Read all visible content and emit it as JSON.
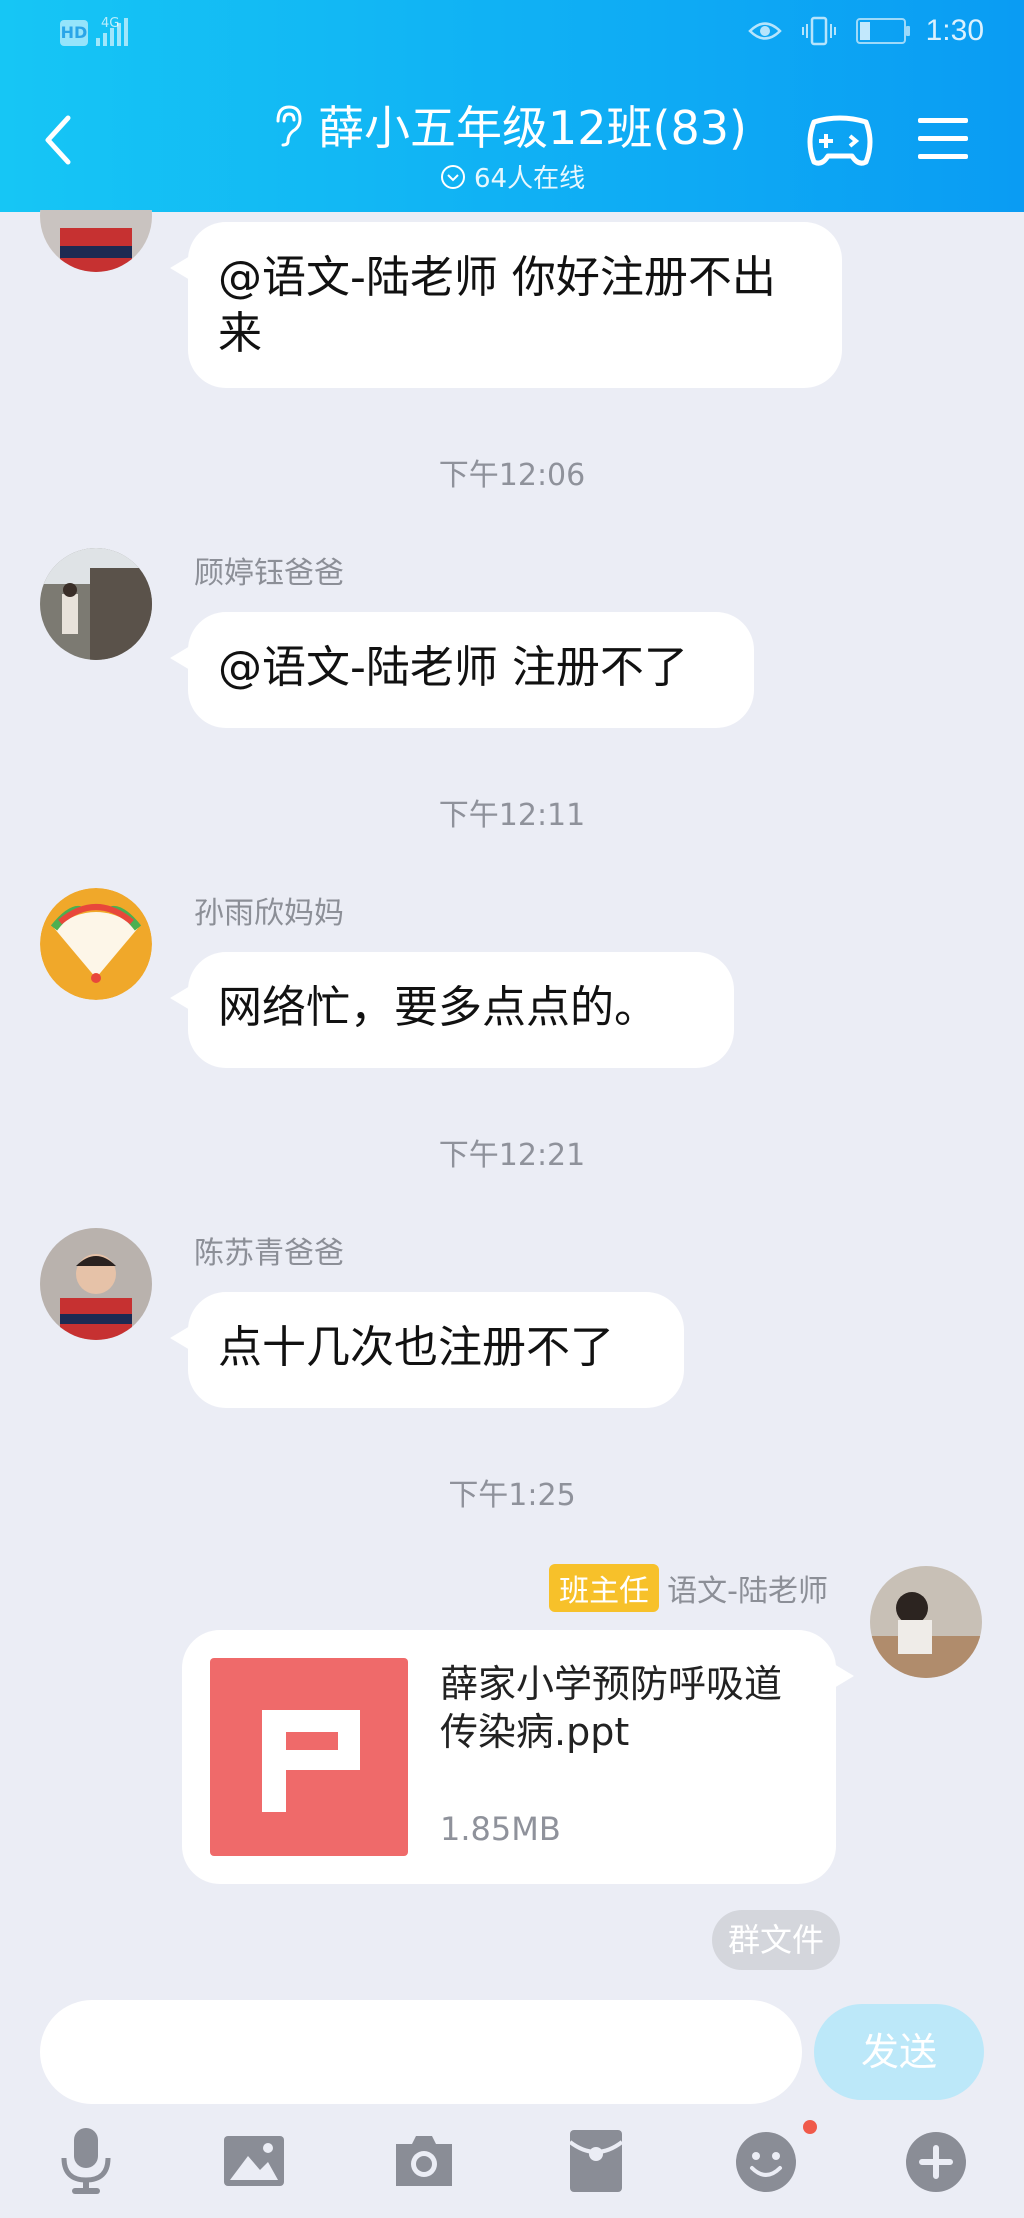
{
  "status_bar": {
    "hd": "HD",
    "network": "4G",
    "time": "1:30"
  },
  "header": {
    "title": "薛小五年级12班(83)",
    "online_text": "64人在线"
  },
  "messages": [
    {
      "text": "@语文-陆老师 你好注册不出来"
    },
    {
      "time": "下午12:06",
      "sender": "顾婷钰爸爸",
      "text": "@语文-陆老师 注册不了"
    },
    {
      "time": "下午12:11",
      "sender": "孙雨欣妈妈",
      "text": "网络忙，要多点点的。"
    },
    {
      "time": "下午12:21",
      "sender": "陈苏青爸爸",
      "text": "点十几次也注册不了"
    },
    {
      "time": "下午1:25",
      "role": "班主任",
      "sender": "语文-陆老师",
      "file": {
        "name": "薛家小学预防呼吸道传染病.ppt",
        "size": "1.85MB"
      }
    }
  ],
  "group_file_label": "群文件",
  "composer": {
    "placeholder": "",
    "send_label": "发送"
  },
  "toolbar": [
    "microphone-icon",
    "image-icon",
    "camera-icon",
    "red-packet-icon",
    "emoji-icon",
    "plus-icon"
  ],
  "colors": {
    "header_start": "#16c6f5",
    "header_end": "#0a9cf3",
    "background": "#ebedf5",
    "badge": "#f7c12a",
    "ppt": "#ef6a6a"
  }
}
